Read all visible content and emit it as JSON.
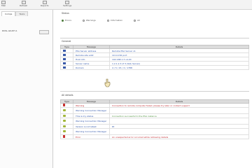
{
  "toolbar": {
    "buttons": [
      {
        "label": "Mail"
      },
      {
        "label": "Refresh"
      },
      {
        "label": "Reports"
      },
      {
        "label": "Settings"
      }
    ]
  },
  "sidebar": {
    "tabs": [
      "Comps",
      "Tasks"
    ],
    "tree_item": "RUSL-GK-DH-1"
  },
  "main": {
    "status_title": "Status",
    "filters": [
      {
        "label": "Errors",
        "checked": true
      },
      {
        "label": "Warnings",
        "checked": false
      },
      {
        "label": "Information",
        "checked": false
      },
      {
        "label": "All",
        "checked": false
      }
    ],
    "general_title": "General",
    "general_headers": [
      "Type",
      "Message",
      "Details"
    ],
    "general_rows": [
      {
        "type": "square",
        "message": "PSA Server address",
        "details": "Remote PSA Server v1"
      },
      {
        "type": "square",
        "message": "Remote site addr",
        "details": "10.4.0.56 port"
      },
      {
        "type": "square",
        "message": "Host info",
        "details": "192.168.1.3 v4.20"
      },
      {
        "type": "square",
        "message": "Server name",
        "details": "1.2.1.2.3 of 3 (SQL Server)"
      },
      {
        "type": "square",
        "message": "Domain",
        "details": "4 / 5 / 15 / 2 / 1788"
      }
    ],
    "all_title": "All details",
    "all_headers": [
      "Type",
      "Message",
      "Details"
    ],
    "all_rows": [
      {
        "type": "flag",
        "message": "Warning",
        "details": "Connection to remote computer failed, please try later or contact support",
        "tone": "red"
      },
      {
        "type": "leaf",
        "message": "Warning Connection Manager",
        "details": "",
        "tone": "blue"
      },
      {
        "type": "leaf",
        "message": "This is my status",
        "details": "Connection successful to the PSA instance",
        "tone": "green"
      },
      {
        "type": "leaf",
        "message": "Warning Connection Manager",
        "details": "",
        "tone": "blue"
      },
      {
        "type": "leaf",
        "message": "Version is not latest",
        "details": "Rt",
        "tone": "blue"
      },
      {
        "type": "leaf",
        "message": "Warning Connection Manager",
        "details": "",
        "tone": "blue"
      },
      {
        "type": "flag",
        "message": "Error",
        "details": "An unexpected error occurred while retrieving details",
        "tone": "red"
      }
    ]
  }
}
